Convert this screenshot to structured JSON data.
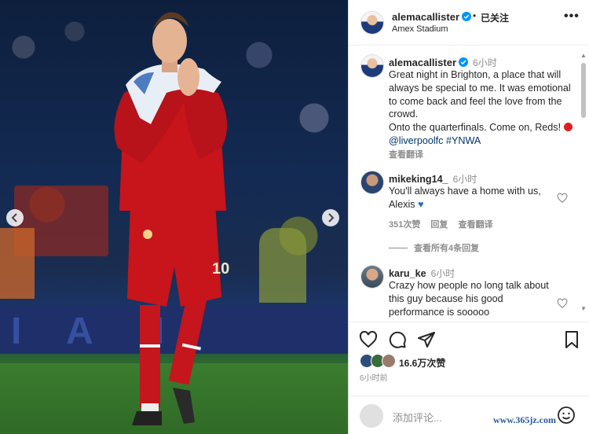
{
  "header": {
    "username": "alemacallister",
    "follow_status": "已关注",
    "dot": "•",
    "location": "Amex Stadium",
    "more": "•••"
  },
  "photo": {
    "banner_letters": [
      "I",
      "A",
      "I"
    ],
    "shirt_number": "10"
  },
  "caption": {
    "username": "alemacallister",
    "time": "6小时",
    "text_1": "Great night in Brighton, a place that will always be special to me. It was emotional to come back and feel the love from the crowd.",
    "text_2": "Onto the quarterfinals. Come on, Reds!",
    "mention": "@liverpoolfc",
    "hashtag": "#YNWA",
    "translate": "查看翻译"
  },
  "comments": [
    {
      "username": "mikeking14_",
      "time": "6小时",
      "text": "You'll always have a home with us, Alexis",
      "likes": "351次赞",
      "reply": "回复",
      "translate": "查看翻译",
      "view_replies": "查看所有4条回复"
    },
    {
      "username": "karu_ke",
      "time": "6小时",
      "text": "Crazy how people no long talk about this guy because his good performance is sooooo"
    }
  ],
  "likes": {
    "count": "16.6万次赞"
  },
  "posted_ago": "6小时前",
  "add_comment": {
    "placeholder": "添加评论..."
  },
  "watermark": "www.365jz.com",
  "colors": {
    "verified": "#0095f6",
    "link": "#00376b",
    "muted": "#8e8e8e",
    "red_ball": "#e0201f",
    "blue_heart": "#1d6fd6"
  },
  "icons": [
    "verified-badge-icon",
    "more-icon",
    "chevron-left-icon",
    "chevron-right-icon",
    "heart-icon",
    "comment-icon",
    "share-icon",
    "bookmark-icon",
    "emoji-icon"
  ]
}
